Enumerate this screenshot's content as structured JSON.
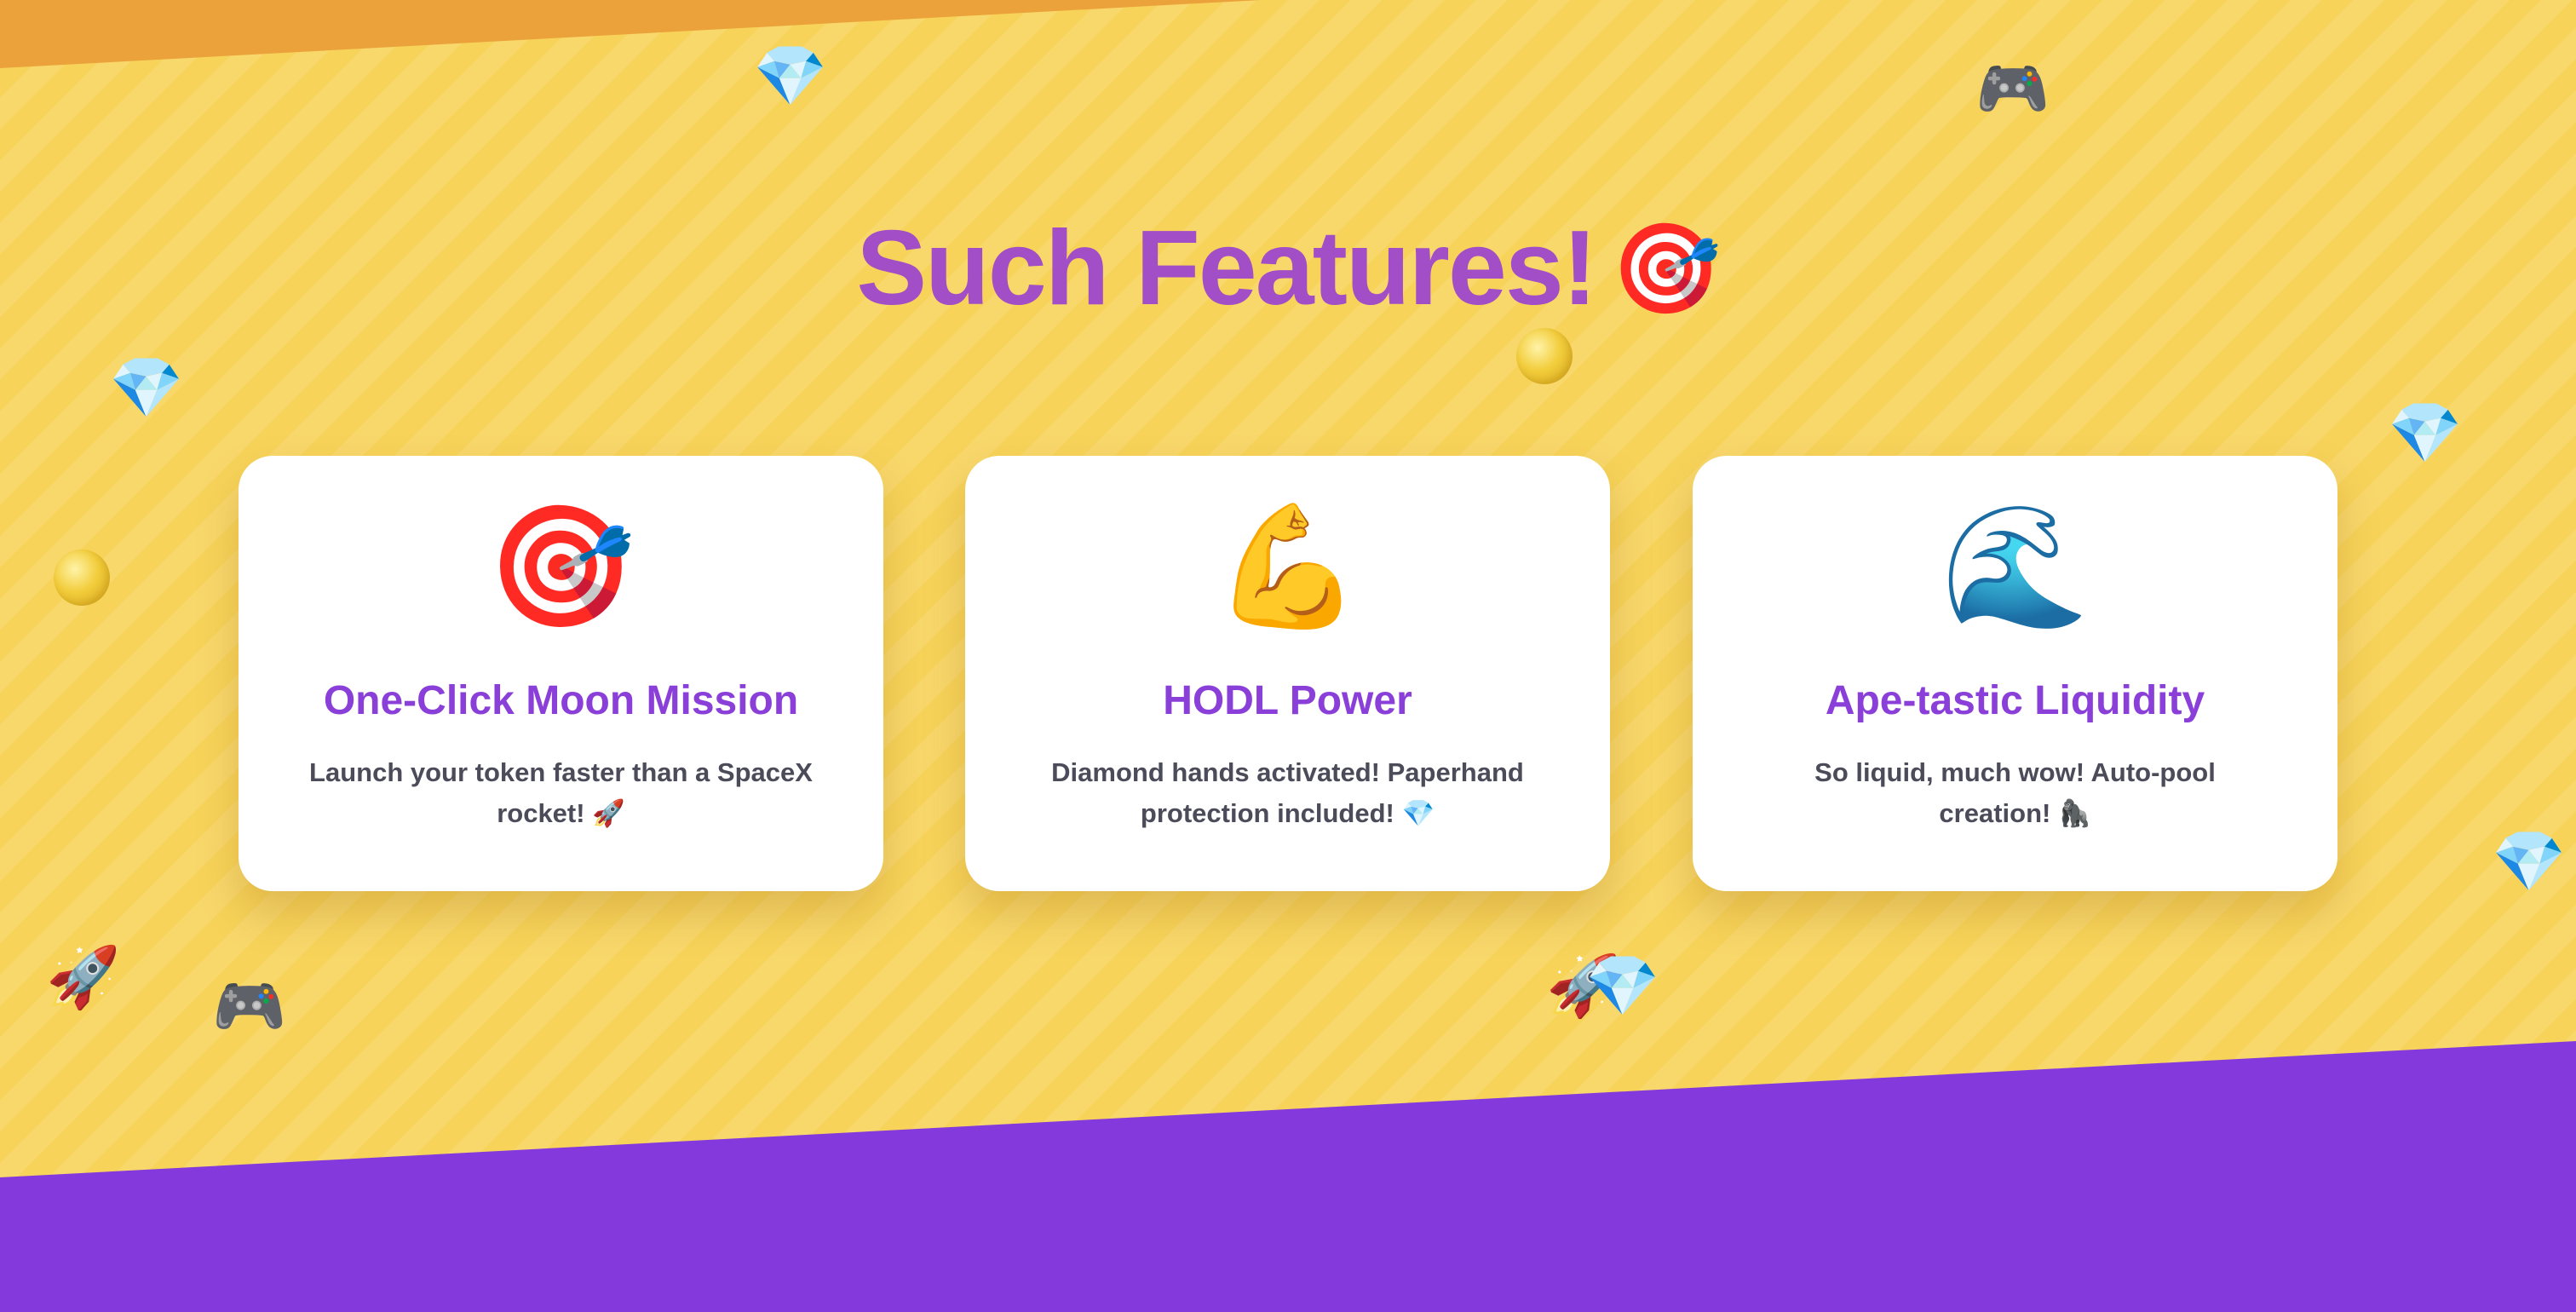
{
  "section": {
    "title": "Such Features!",
    "title_emoji": "🎯"
  },
  "cards": [
    {
      "icon": "🎯",
      "icon_name": "target-dart-icon",
      "title": "One-Click Moon Mission",
      "description": "Launch your token faster than a SpaceX rocket! 🚀"
    },
    {
      "icon": "💪",
      "icon_name": "flexed-biceps-icon",
      "title": "HODL Power",
      "description": "Diamond hands activated! Paperhand protection included! 💎"
    },
    {
      "icon": "🌊",
      "icon_name": "water-wave-icon",
      "title": "Ape-tastic Liquidity",
      "description": "So liquid, much wow! Auto-pool creation! 🦍"
    }
  ],
  "decorations": {
    "diamond": "💎",
    "gamepad": "🎮",
    "rocket": "🚀"
  },
  "colors": {
    "background": "#f7d35a",
    "top_band": "#eba23a",
    "bottom_band": "#8439dd",
    "title": "#a24ec7",
    "card_title": "#8b3fd9",
    "card_text": "#4b4b5a",
    "card_background": "#ffffff"
  }
}
